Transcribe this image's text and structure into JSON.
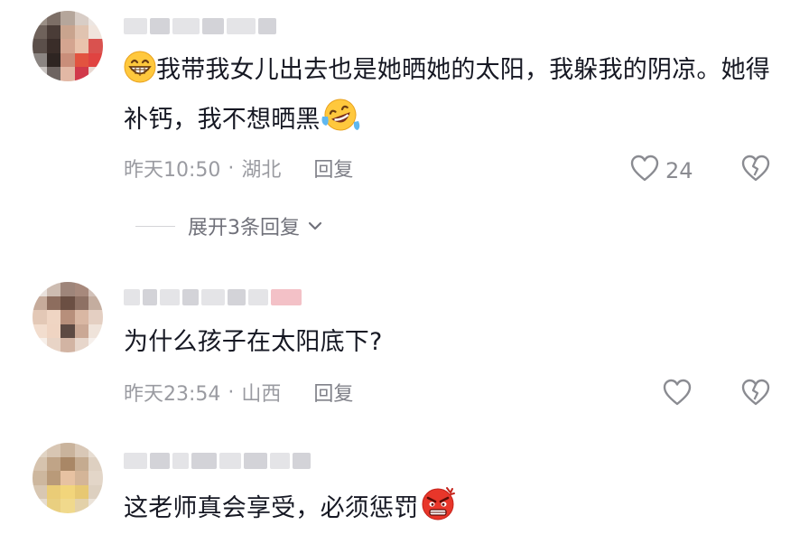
{
  "comments": [
    {
      "username_blurred": "HONGJIBO",
      "text_part1": "我带我女儿出去也是她晒她的太阳，我躲我的阴凉。她得补钙，我不想晒黑",
      "lead_emoji": "grin-emoji",
      "trail_emoji": "laugh-tears-emoji",
      "time": "昨天10:50",
      "location": "湖北",
      "reply_label": "回复",
      "like_count": "24",
      "expand_replies": "展开3条回复"
    },
    {
      "username_blurred": "",
      "text_part1": "为什么孩子在太阳底下?",
      "time": "昨天23:54",
      "location": "山西",
      "reply_label": "回复",
      "like_count": ""
    },
    {
      "username_blurred": "",
      "text_part1": "这老师真会享受，必须惩罚",
      "trail_emoji": "angry-face-emoji"
    }
  ],
  "separator": "·",
  "colors": {
    "text_primary": "#161823",
    "text_secondary": "#9a9ba1",
    "icon_gray": "#8a8b91",
    "angry_red": "#e8362a",
    "emoji_yellow": "#ffc83d"
  }
}
